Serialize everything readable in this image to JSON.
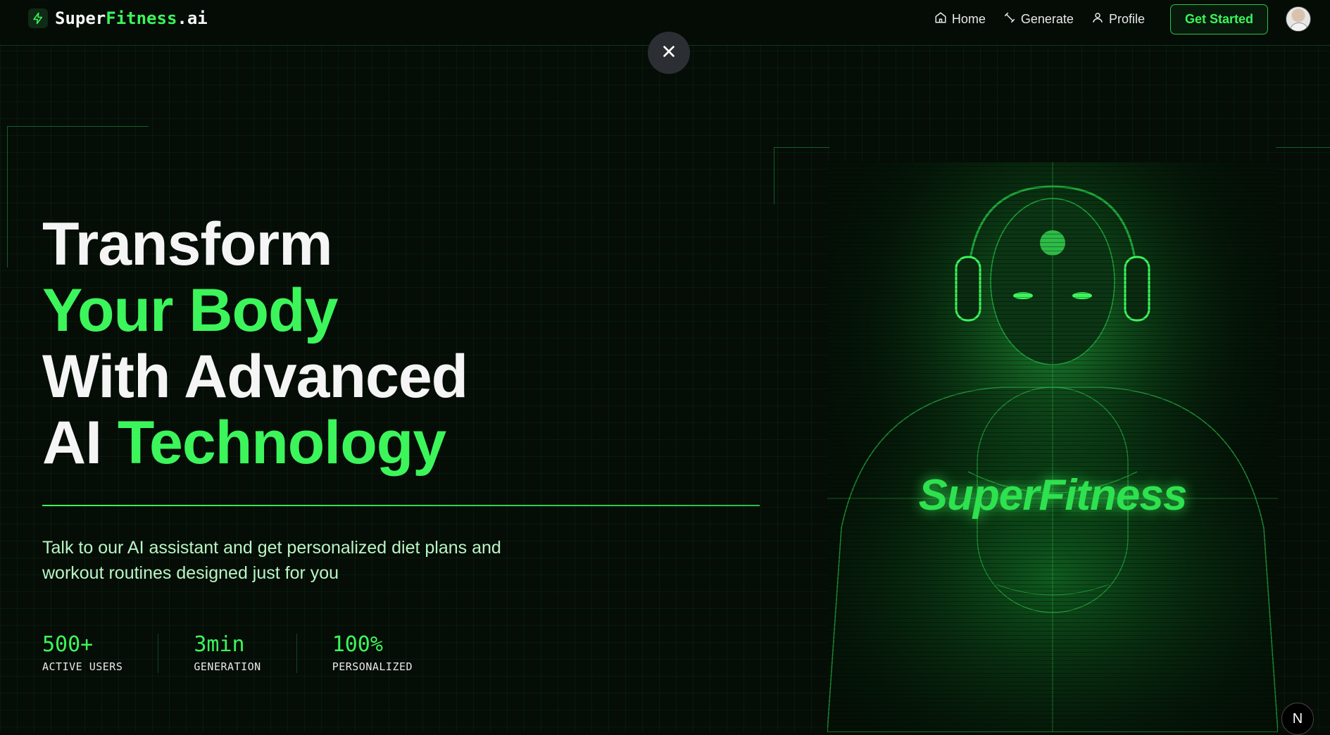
{
  "header": {
    "logo": {
      "part1": "Super",
      "part2": "Fitness",
      "part3": ".ai"
    },
    "nav": [
      {
        "label": "Home",
        "icon": "home-icon"
      },
      {
        "label": "Generate",
        "icon": "dumbbell-icon"
      },
      {
        "label": "Profile",
        "icon": "user-icon"
      }
    ],
    "cta_label": "Get Started"
  },
  "hero": {
    "title_line1": "Transform",
    "title_line2": "Your Body",
    "title_line3": "With Advanced",
    "title_line4_a": "AI",
    "title_line4_b": "Technology",
    "subtitle": "Talk to our AI assistant and get personalized diet plans and workout routines designed just for you",
    "image_brand_text": "SuperFitness"
  },
  "stats": [
    {
      "value": "500+",
      "label": "ACTIVE USERS"
    },
    {
      "value": "3min",
      "label": "GENERATION"
    },
    {
      "value": "100%",
      "label": "PERSONALIZED"
    }
  ],
  "badge": "N",
  "colors": {
    "accent": "#3cf55b",
    "background": "#050d06",
    "text": "#f5f5f5"
  }
}
